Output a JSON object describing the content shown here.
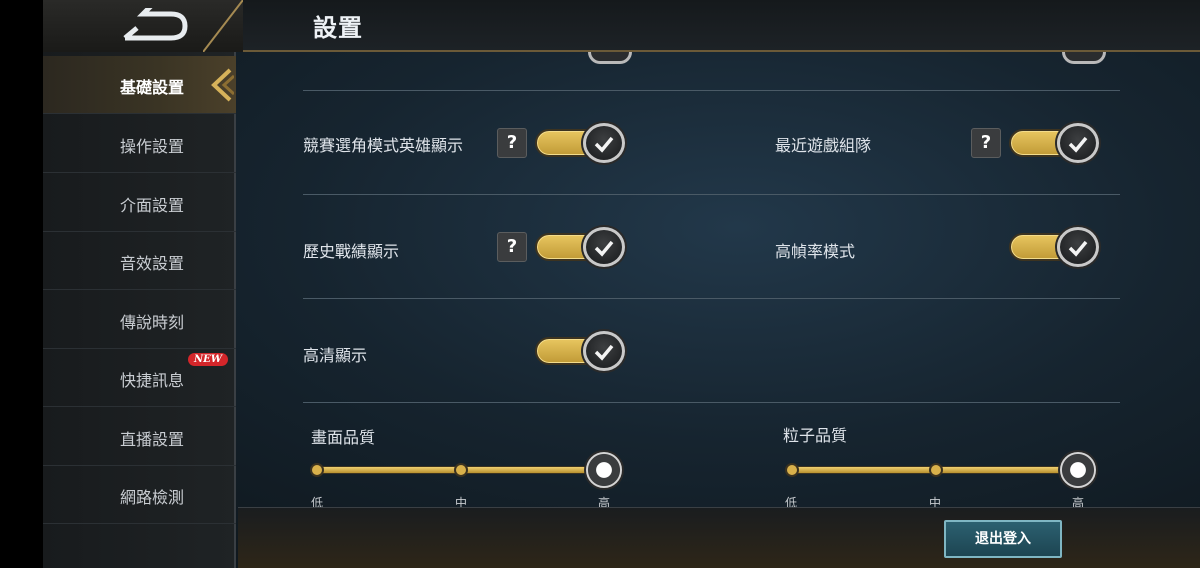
{
  "header": {
    "title": "設置"
  },
  "sidebar": {
    "items": [
      {
        "label": "基礎設置",
        "active": true
      },
      {
        "label": "操作設置"
      },
      {
        "label": "介面設置"
      },
      {
        "label": "音效設置"
      },
      {
        "label": "傳說時刻"
      },
      {
        "label": "快捷訊息",
        "badge": "NEW"
      },
      {
        "label": "直播設置"
      },
      {
        "label": "網路檢測"
      }
    ]
  },
  "settings": {
    "help_glyph": "?",
    "toggles": [
      {
        "label": "競賽選角模式英雄顯示",
        "on": true
      },
      {
        "label": "最近遊戲組隊",
        "on": true
      },
      {
        "label": "歷史戰績顯示",
        "on": true
      },
      {
        "label": "高幀率模式",
        "on": true
      },
      {
        "label": "高清顯示",
        "on": true
      }
    ],
    "sliders": [
      {
        "title": "畫面品質",
        "ticks": [
          "低",
          "中",
          "高"
        ],
        "value": "高"
      },
      {
        "title": "粒子品質",
        "ticks": [
          "低",
          "中",
          "高"
        ],
        "value": "高"
      }
    ]
  },
  "footer": {
    "logout_label": "退出登入"
  },
  "colors": {
    "accent_gold": "#d9b14b",
    "logout_teal": "#2c6070",
    "badge_red": "#d4262a"
  }
}
